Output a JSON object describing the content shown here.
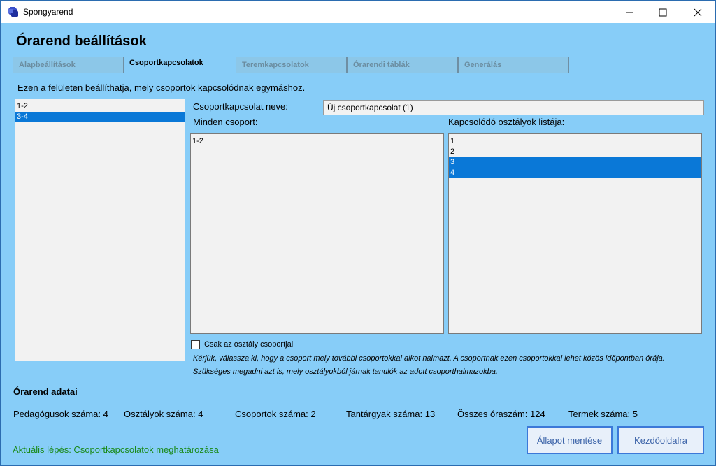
{
  "window": {
    "title": "Spongyarend",
    "icon": "app-cube-icon"
  },
  "page": {
    "title": "Órarend beállítások",
    "description": "Ezen a felületen beállíthatja, mely csoportok kapcsolódnak egymáshoz."
  },
  "tabs": [
    {
      "label": "Alapbeállítások",
      "active": false
    },
    {
      "label": "Csoportkapcsolatok",
      "active": true
    },
    {
      "label": "Teremkapcsolatok",
      "active": false
    },
    {
      "label": "Órarendi táblák",
      "active": false
    },
    {
      "label": "Generálás",
      "active": false
    }
  ],
  "group_links": {
    "items": [
      "1-2",
      "3-4"
    ],
    "selected_index": 1
  },
  "form": {
    "name_label": "Csoportkapcsolat neve:",
    "name_value": "Új csoportkapcsolat (1)",
    "all_groups_label": "Minden csoport:",
    "all_groups": [
      "1-2"
    ],
    "classes_label": "Kapcsolódó osztályok listája:",
    "classes": [
      {
        "label": "1",
        "selected": false
      },
      {
        "label": "2",
        "selected": false
      },
      {
        "label": "3",
        "selected": true
      },
      {
        "label": "4",
        "selected": true
      }
    ],
    "checkbox_label": "Csak az osztály csoportjai",
    "checkbox_checked": false,
    "hint_line1": "Kérjük, válassza ki, hogy a csoport mely további csoportokkal alkot halmazt. A csoportnak ezen csoportokkal lehet közös időpontban órája.",
    "hint_line2": "Szükséges megadni azt is, mely osztályokból járnak tanulók az adott csoporthalmazokba."
  },
  "summary": {
    "title": "Órarend adatai",
    "stats": [
      "Pedagógusok száma: 4",
      "Osztályok száma: 4",
      "Csoportok száma: 2",
      "Tantárgyak száma: 13",
      "Összes óraszám: 124",
      "Termek száma: 5"
    ]
  },
  "status": {
    "text": "Aktuális lépés: Csoportkapcsolatok meghatározása"
  },
  "buttons": {
    "save": "Állapot mentése",
    "home": "Kezdőoldalra"
  },
  "colors": {
    "background": "#87cdf8",
    "selection": "#0a78d7",
    "status_text": "#1a8a1a",
    "button_border": "#3c78d8"
  }
}
